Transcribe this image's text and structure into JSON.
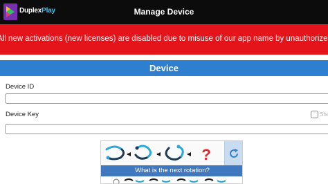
{
  "header": {
    "logo_text_part1": "Duplex",
    "logo_text_part2": "Play",
    "title": "Manage Device"
  },
  "notice": {
    "text": "All new activations (new licenses) are disabled due to misuse of our app name by unauthorized websites."
  },
  "panel": {
    "title": "Device"
  },
  "form": {
    "device_id_label": "Device ID",
    "device_id_value": "",
    "device_key_label": "Device Key",
    "device_key_value": "",
    "show_label": "Show"
  },
  "captcha": {
    "question": "What is the next rotation?",
    "refresh_icon": "refresh-icon",
    "colors": {
      "accent": "#2aa6d8",
      "question_mark": "#e0262b"
    }
  },
  "colors": {
    "topbar": "#0c0c0c",
    "notice": "#e4141a",
    "panel_header": "#2f7fd1",
    "captcha_bar": "#3f78bf"
  }
}
